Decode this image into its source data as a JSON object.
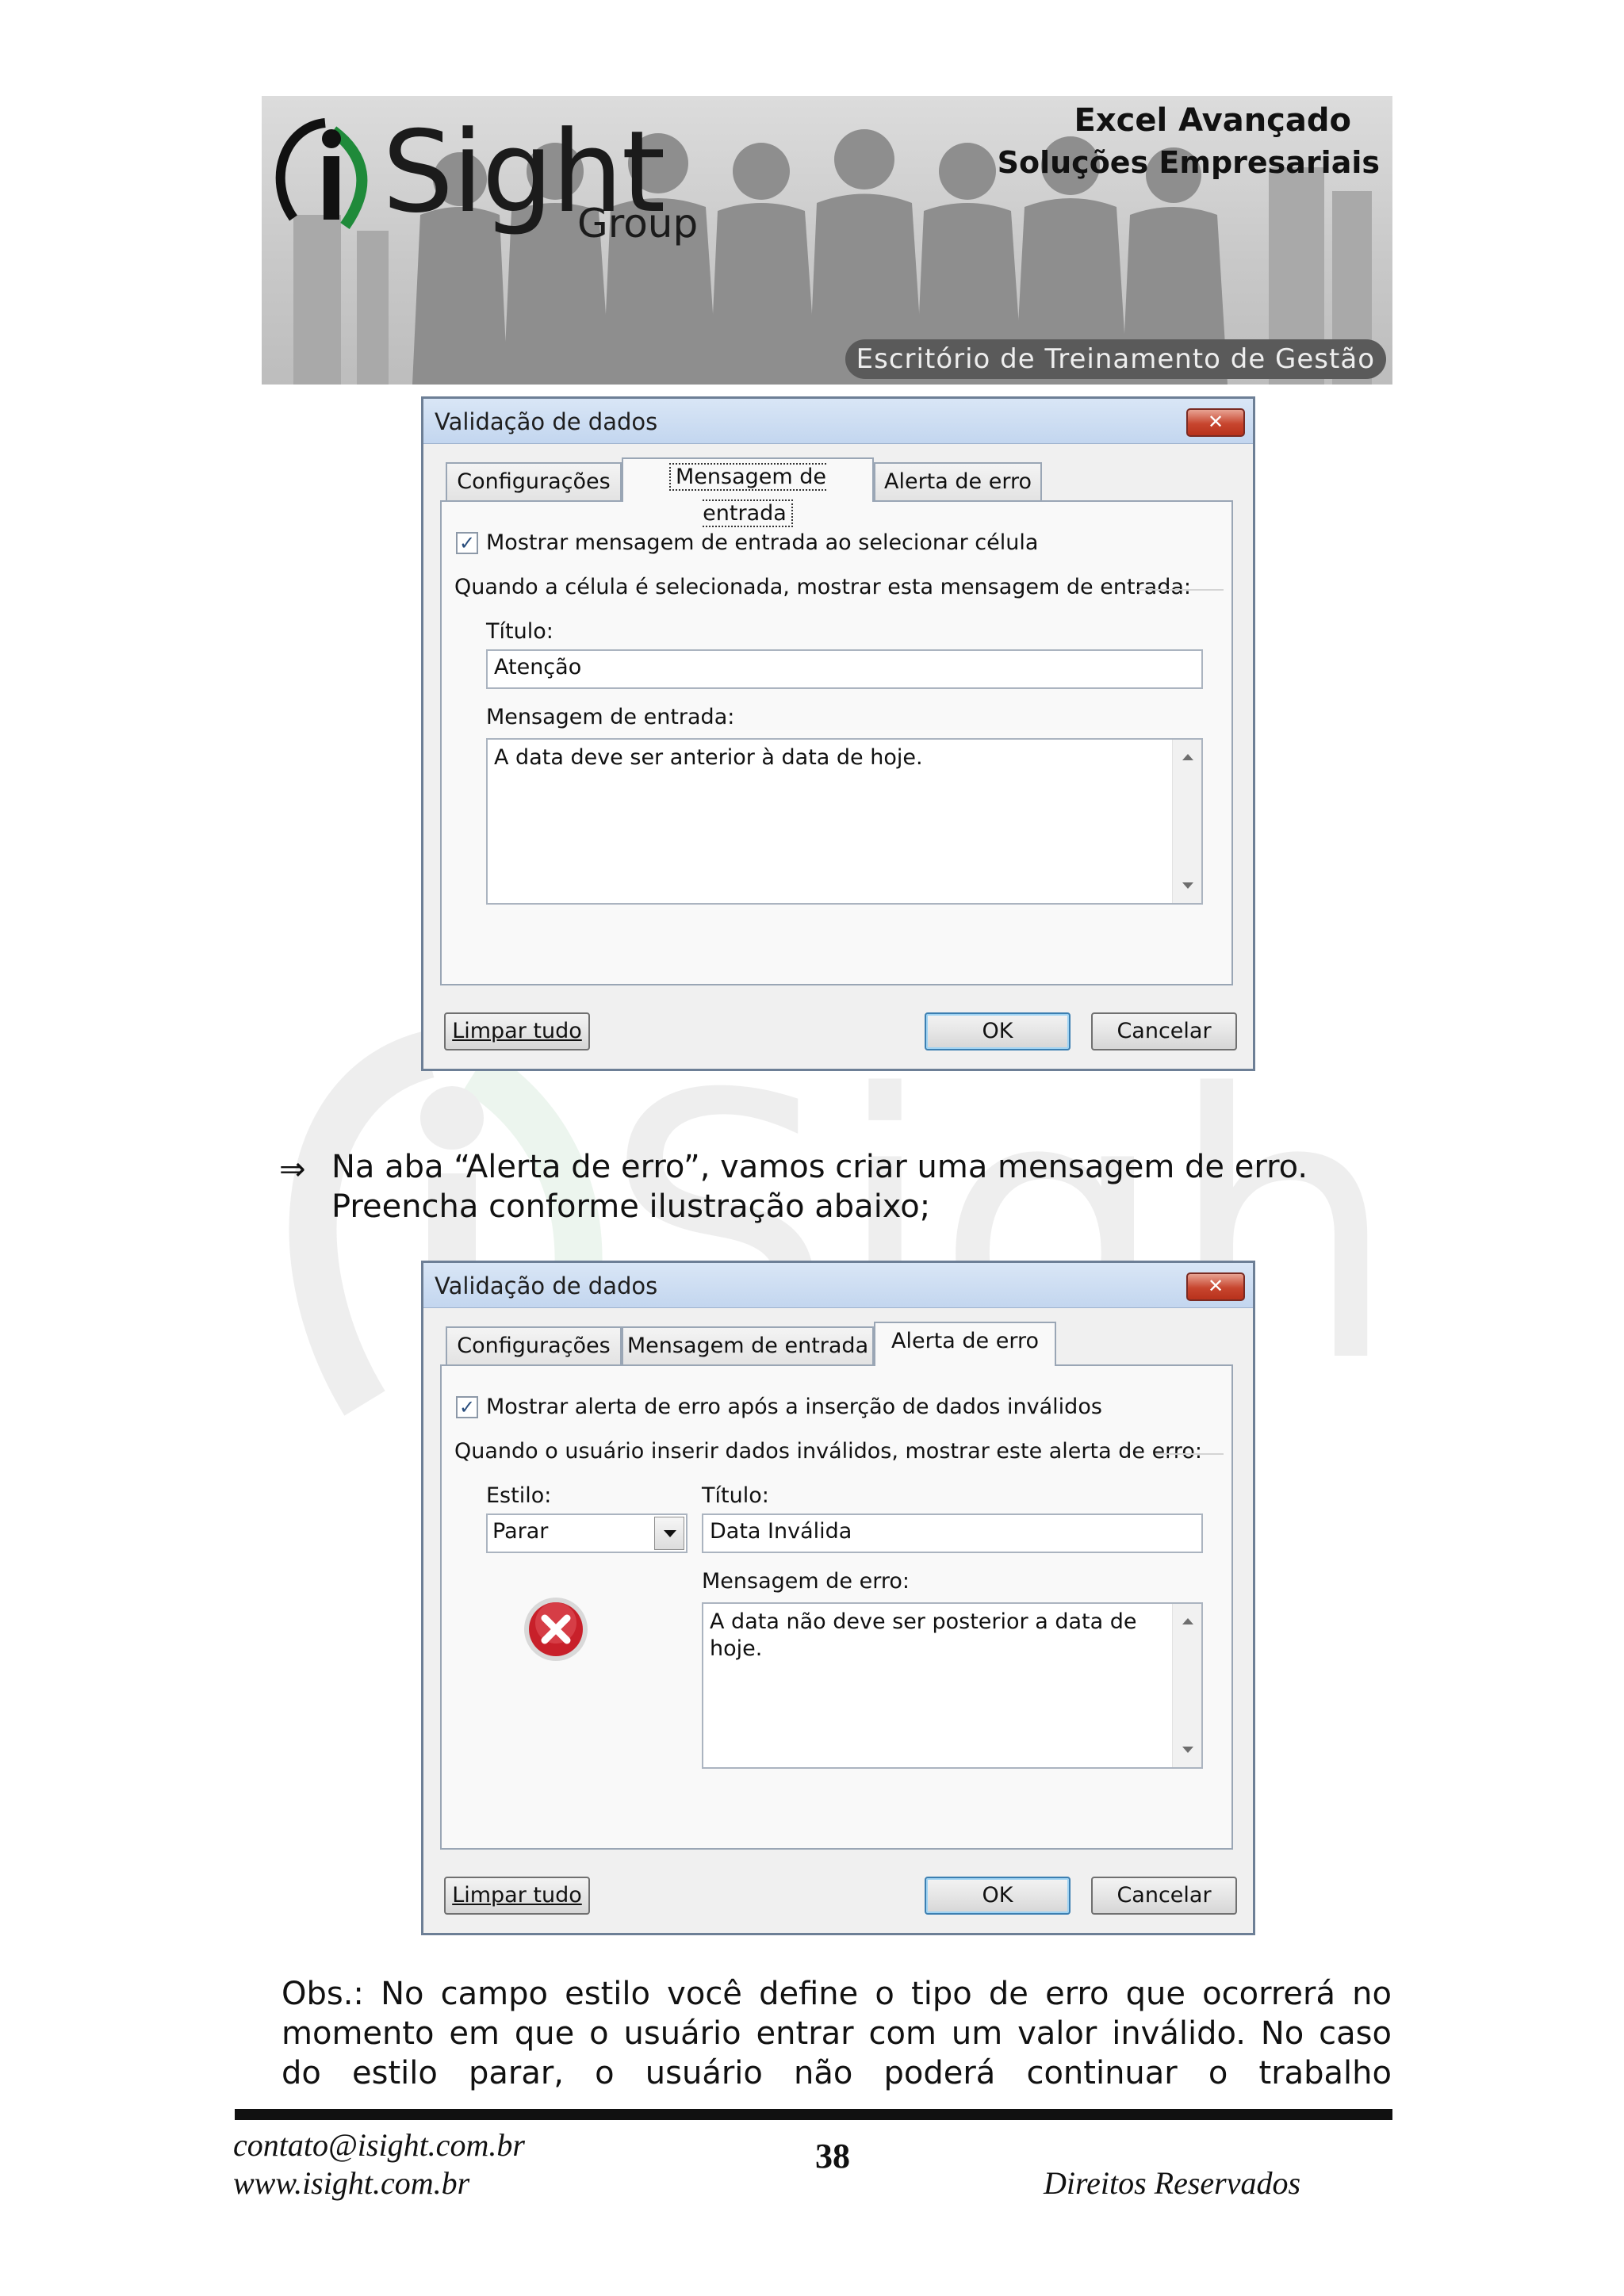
{
  "banner": {
    "logo_text": "Sight",
    "logo_group": "Group",
    "title1": "Excel Avançado",
    "title2": "Soluções Empresariais",
    "pill": "Escritório de Treinamento de Gestão"
  },
  "dialog1": {
    "title": "Validação de dados",
    "close_glyph": "✕",
    "tabs": [
      "Configurações",
      "Mensagem de entrada",
      "Alerta de erro"
    ],
    "active_tab": "Mensagem de entrada",
    "checkbox_label": "Mostrar mensagem de entrada ao selecionar célula",
    "checkbox_checked": true,
    "group_label": "Quando a célula é selecionada, mostrar esta mensagem de entrada:",
    "title_label": "Título:",
    "title_value": "Atenção",
    "message_label": "Mensagem de entrada:",
    "message_value": "A data deve ser anterior à data de hoje.",
    "clear_button": "Limpar tudo",
    "ok_button": "OK",
    "cancel_button": "Cancelar"
  },
  "instruction": {
    "arrow": "⇒",
    "line1": "Na aba “Alerta de erro”, vamos criar uma mensagem de erro.",
    "line2": "Preencha conforme ilustração abaixo;"
  },
  "dialog2": {
    "title": "Validação de dados",
    "close_glyph": "✕",
    "tabs": [
      "Configurações",
      "Mensagem de entrada",
      "Alerta de erro"
    ],
    "active_tab": "Alerta de erro",
    "checkbox_label": "Mostrar alerta de erro após a inserção de dados inválidos",
    "checkbox_checked": true,
    "group_label": "Quando o usuário inserir dados inválidos, mostrar este alerta de erro:",
    "style_label": "Estilo:",
    "style_value": "Parar",
    "title_label": "Título:",
    "title_value": "Data Inválida",
    "message_label": "Mensagem de erro:",
    "message_value": "A data não deve ser posterior a data de hoje.",
    "clear_button": "Limpar tudo",
    "ok_button": "OK",
    "cancel_button": "Cancelar",
    "icon": "stop-error-icon"
  },
  "obs": {
    "line1": "Obs.: No campo estilo você define o tipo de erro que ocorrerá no",
    "line2": "momento em que o usuário entrar com um valor inválido. No caso",
    "line3": "do estilo parar, o usuário não poderá continuar o trabalho"
  },
  "footer": {
    "email": "contato@isight.com.br",
    "website": "www.isight.com.br",
    "page_number": "38",
    "rights": "Direitos Reservados"
  },
  "colors": {
    "titlebar": "#c3d6ef",
    "close_red": "#c7452e",
    "logo_green": "#1f8a3a",
    "stop_red": "#c8202a"
  }
}
